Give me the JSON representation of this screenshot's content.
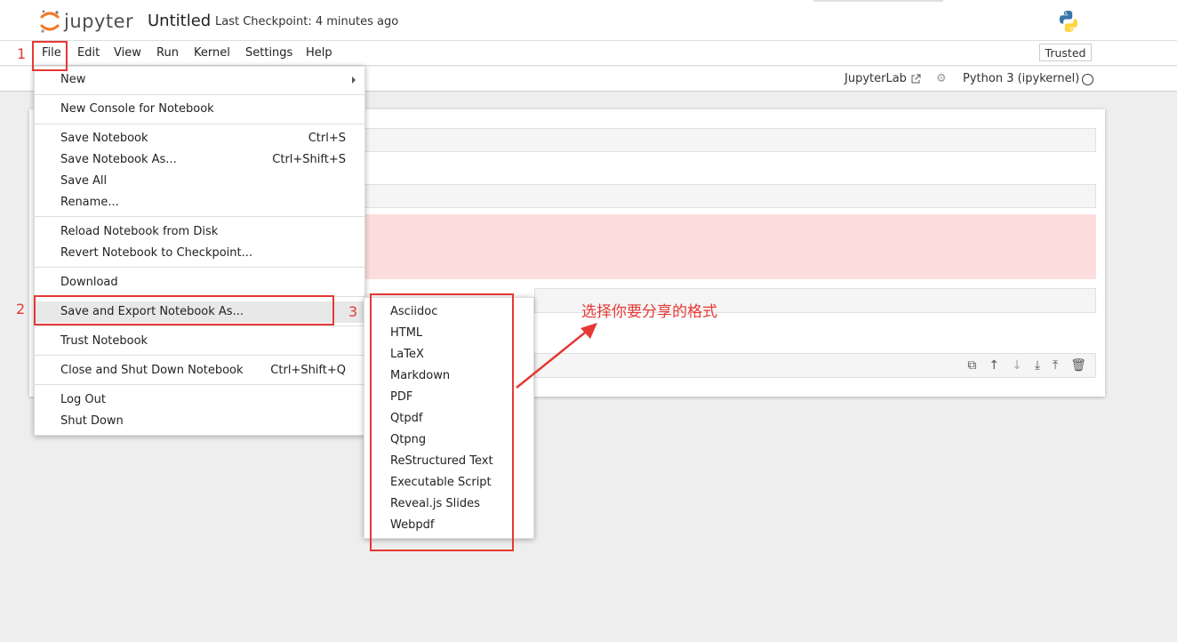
{
  "header": {
    "brand": "jupyter",
    "notebook_title": "Untitled",
    "checkpoint": "Last Checkpoint: 4 minutes ago"
  },
  "menubar": {
    "items": [
      "File",
      "Edit",
      "View",
      "Run",
      "Kernel",
      "Settings",
      "Help"
    ],
    "trusted": "Trusted"
  },
  "toolbar": {
    "jupyterlab_link": "JupyterLab",
    "kernel": "Python 3 (ipykernel)"
  },
  "file_menu": {
    "new": "New",
    "new_console": "New Console for Notebook",
    "save": "Save Notebook",
    "save_shortcut": "Ctrl+S",
    "save_as": "Save Notebook As...",
    "save_as_shortcut": "Ctrl+Shift+S",
    "save_all": "Save All",
    "rename": "Rename...",
    "reload": "Reload Notebook from Disk",
    "revert": "Revert Notebook to Checkpoint...",
    "download": "Download",
    "export": "Save and Export Notebook As...",
    "trust": "Trust Notebook",
    "close_shutdown": "Close and Shut Down Notebook",
    "close_shutdown_shortcut": "Ctrl+Shift+Q",
    "logout": "Log Out",
    "shutdown": "Shut Down"
  },
  "export_menu": {
    "items": [
      "Asciidoc",
      "HTML",
      "LaTeX",
      "Markdown",
      "PDF",
      "Qtpdf",
      "Qtpng",
      "ReStructured Text",
      "Executable Script",
      "Reveal.js Slides",
      "Webpdf"
    ]
  },
  "annotations": {
    "step1": "1",
    "step2": "2",
    "step3": "3",
    "note": "选择你要分享的格式",
    "color": "#e53935"
  }
}
